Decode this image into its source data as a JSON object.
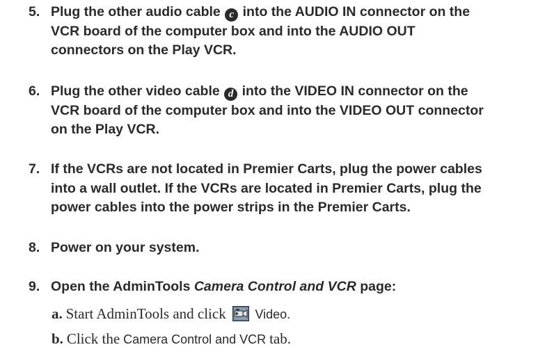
{
  "steps": [
    {
      "number": "5.",
      "line1_pre": "Plug the other audio cable",
      "badge": "c",
      "line1_post": "into the AUDIO IN connector on the",
      "line2": "VCR board of the computer box and into the AUDIO OUT",
      "line3": "connectors on the Play VCR."
    },
    {
      "number": "6.",
      "line1_pre": "Plug the other video cable",
      "badge": "d",
      "line1_post": "into the VIDEO IN connector on the",
      "line2": "VCR board of the computer box and into the VIDEO OUT connector",
      "line3": "on the Play VCR."
    },
    {
      "number": "7.",
      "line1": "If the VCRs are not located in Premier Carts, plug the power cables",
      "line2": "into a wall outlet. If the VCRs are located in Premier Carts, plug the",
      "line3": "power cables into the power strips in the Premier Carts."
    },
    {
      "number": "8.",
      "line1": "Power on your system."
    },
    {
      "number": "9.",
      "pre": "Open the AdminTools",
      "italic": "Camera Control and VCR",
      "post": "page:"
    }
  ],
  "substeps": {
    "a": {
      "letter": "a.",
      "serif_text": "Start AdminTools and click",
      "icon": "video-camera-icon",
      "sans_text": "Video."
    },
    "b": {
      "letter": "b.",
      "serif_pre": "Click the",
      "sans_text": "Camera Control and VCR",
      "serif_post": "tab."
    }
  }
}
